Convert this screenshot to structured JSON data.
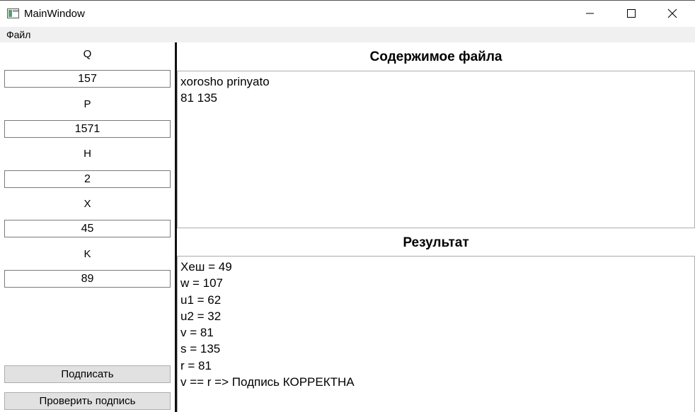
{
  "window": {
    "title": "MainWindow"
  },
  "menu": {
    "file_label": "Файл"
  },
  "params": [
    {
      "label": "Q",
      "value": "157"
    },
    {
      "label": "P",
      "value": "1571"
    },
    {
      "label": "H",
      "value": "2"
    },
    {
      "label": "X",
      "value": "45"
    },
    {
      "label": "K",
      "value": "89"
    }
  ],
  "buttons": {
    "sign_label": "Подписать",
    "verify_label": "Проверить подпись"
  },
  "file_section": {
    "title": "Содержимое файла",
    "lines": [
      "xorosho prinyato",
      "81 135"
    ]
  },
  "result_section": {
    "title": "Результат",
    "lines": [
      "Хеш = 49",
      "w = 107",
      "u1 = 62",
      "u2 = 32",
      "v = 81",
      "s = 135",
      "r = 81",
      "v == r => Подпись КОРРЕКТНА"
    ]
  }
}
